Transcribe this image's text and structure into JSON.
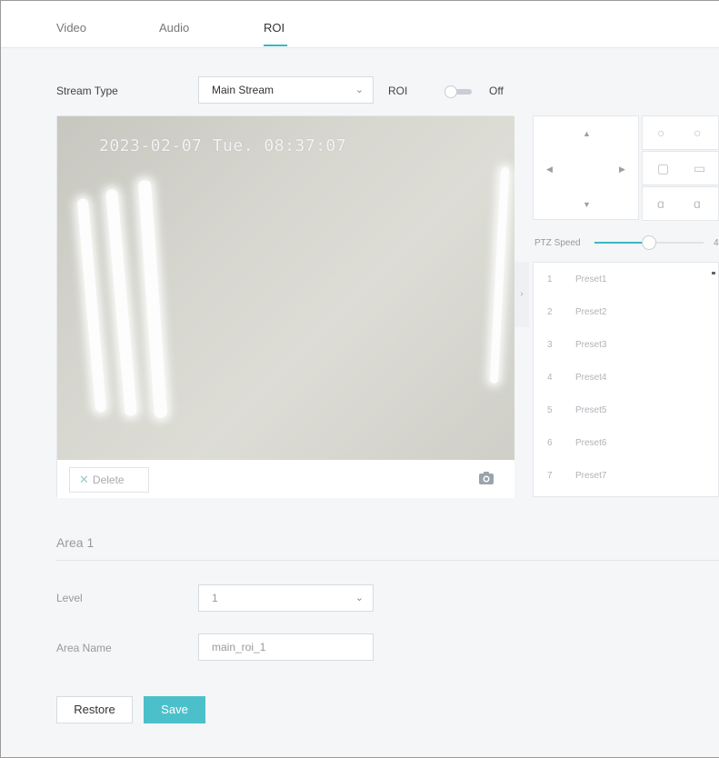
{
  "tabs": [
    {
      "label": "Video"
    },
    {
      "label": "Audio"
    },
    {
      "label": "ROI",
      "active": true
    }
  ],
  "stream_type": {
    "label": "Stream Type",
    "value": "Main Stream"
  },
  "roi": {
    "label": "ROI",
    "state": "Off"
  },
  "video": {
    "timestamp": "2023-02-07 Tue. 08:37:07",
    "delete_label": "Delete"
  },
  "ptz": {
    "speed_label": "PTZ Speed",
    "speed_value": "4",
    "speed_fraction": 0.5,
    "presets": [
      {
        "num": "1",
        "name": "Preset1"
      },
      {
        "num": "2",
        "name": "Preset2"
      },
      {
        "num": "3",
        "name": "Preset3"
      },
      {
        "num": "4",
        "name": "Preset4"
      },
      {
        "num": "5",
        "name": "Preset5"
      },
      {
        "num": "6",
        "name": "Preset6"
      },
      {
        "num": "7",
        "name": "Preset7"
      }
    ]
  },
  "area": {
    "title": "Area 1",
    "level_label": "Level",
    "level_value": "1",
    "name_label": "Area Name",
    "name_value": "main_roi_1"
  },
  "actions": {
    "restore": "Restore",
    "save": "Save"
  },
  "colors": {
    "accent": "#3bb7c4",
    "save_button": "#4cc0ca"
  }
}
